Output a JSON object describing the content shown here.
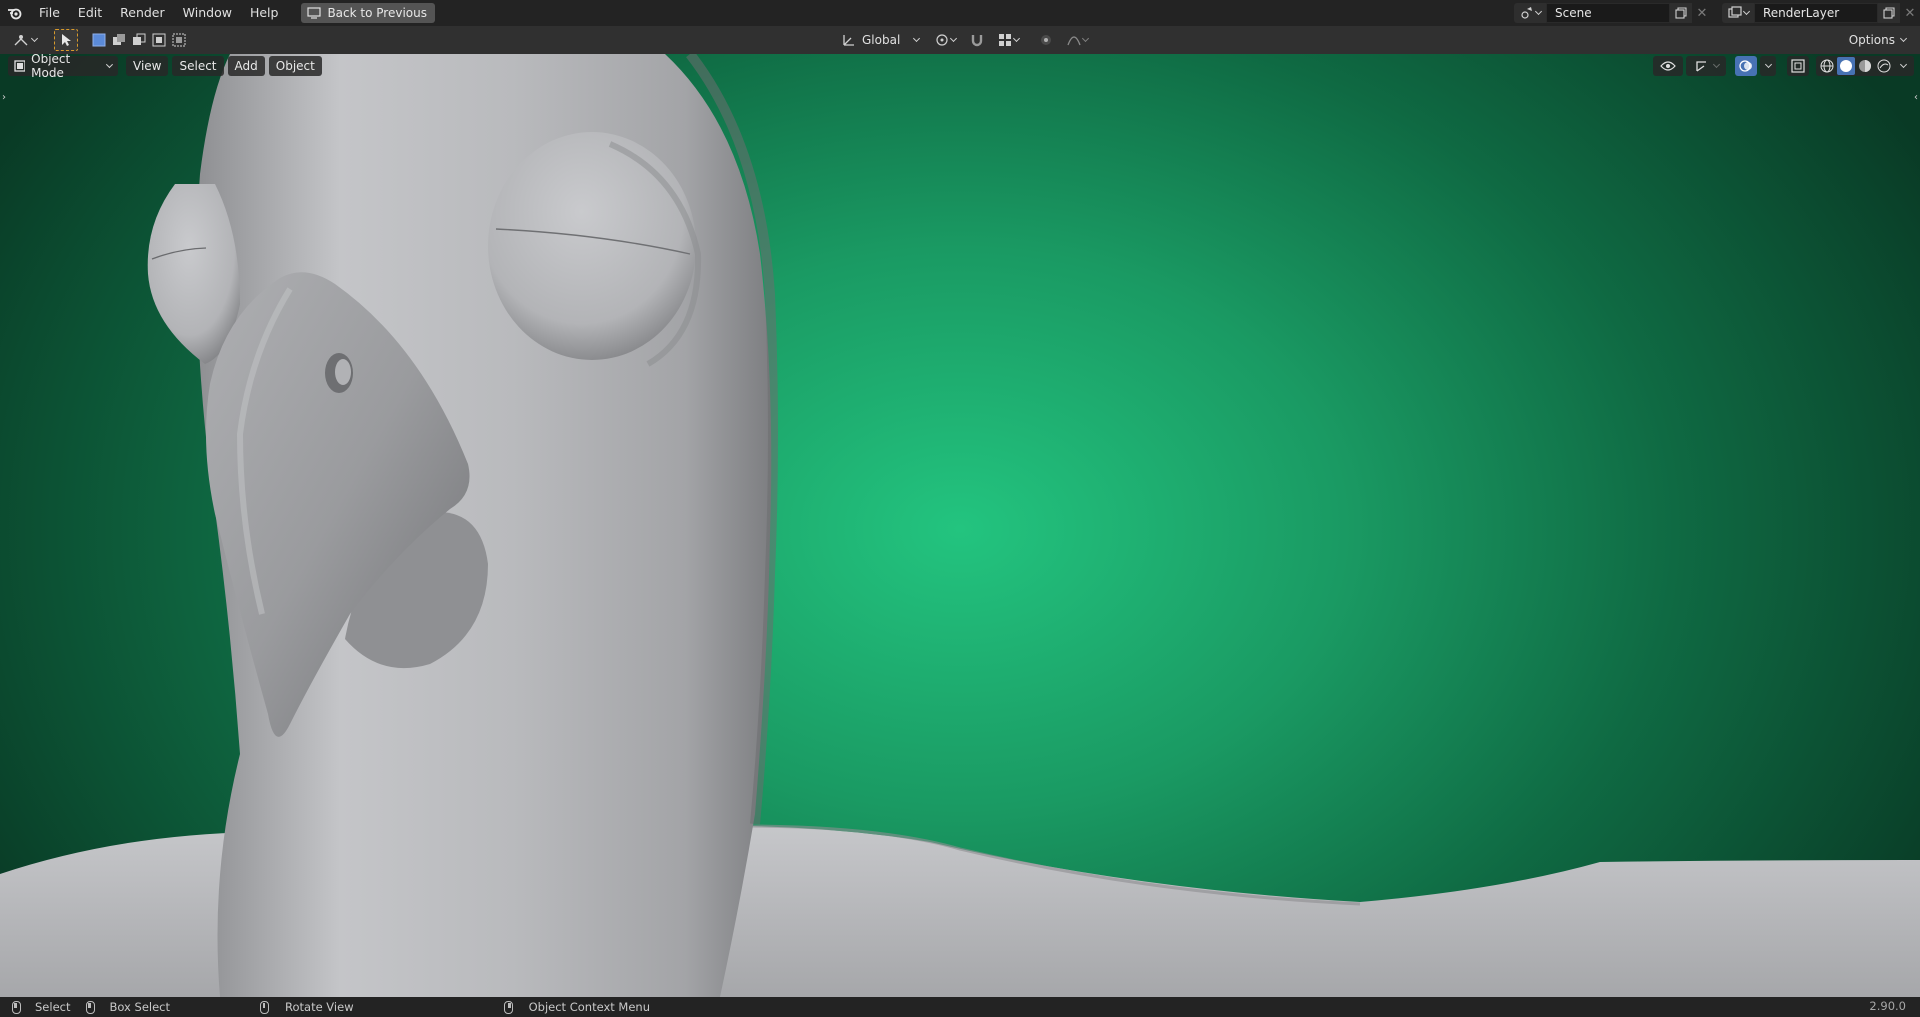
{
  "menu": {
    "items": [
      "File",
      "Edit",
      "Render",
      "Window",
      "Help"
    ],
    "back_label": "Back to Previous"
  },
  "scene": {
    "name": "Scene"
  },
  "render_layer": {
    "name": "RenderLayer"
  },
  "tool_header": {
    "orientation": "Global",
    "options_label": "Options"
  },
  "viewport": {
    "mode": "Object Mode",
    "menus": [
      "View",
      "Select",
      "Add",
      "Object"
    ],
    "background_color": "#23c47f",
    "model_color": "#b8b9bb"
  },
  "status": {
    "select": "Select",
    "box_select": "Box Select",
    "rotate_view": "Rotate View",
    "context_menu": "Object Context Menu",
    "version": "2.90.0"
  },
  "colors": {
    "accent": "#4772b3",
    "active_tool_outline": "#d89a2c"
  }
}
